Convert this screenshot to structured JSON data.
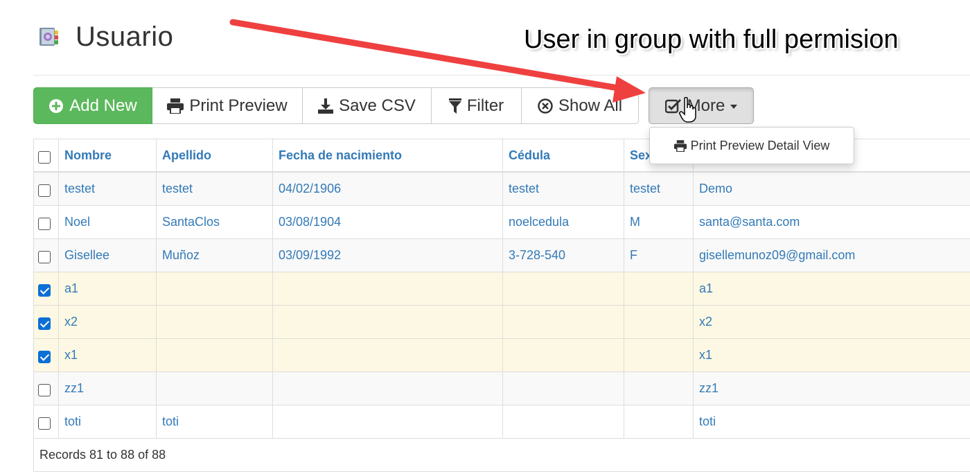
{
  "page": {
    "title": "Usuario",
    "annotation": "User in group with full permision"
  },
  "toolbar": {
    "add_new": "Add New",
    "print_preview": "Print Preview",
    "save_csv": "Save CSV",
    "filter": "Filter",
    "show_all": "Show All",
    "more": "More"
  },
  "dropdown": {
    "items": [
      "Print Preview Detail View"
    ]
  },
  "table": {
    "columns": [
      "Nombre",
      "Apellido",
      "Fecha de nacimiento",
      "Cédula",
      "Sex",
      ""
    ],
    "rows": [
      {
        "checked": false,
        "cells": [
          "testet",
          "testet",
          "04/02/1906",
          "testet",
          "testet",
          "Demo"
        ]
      },
      {
        "checked": false,
        "cells": [
          "Noel",
          "SantaClos",
          "03/08/1904",
          "noelcedula",
          "M",
          "santa@santa.com"
        ]
      },
      {
        "checked": false,
        "cells": [
          "Gisellee",
          "Muñoz",
          "03/09/1992",
          "3-728-540",
          "F",
          "gisellemunoz09@gmail.com"
        ]
      },
      {
        "checked": true,
        "cells": [
          "a1",
          "",
          "",
          "",
          "",
          "a1"
        ]
      },
      {
        "checked": true,
        "cells": [
          "x2",
          "",
          "",
          "",
          "",
          "x2"
        ]
      },
      {
        "checked": true,
        "cells": [
          "x1",
          "",
          "",
          "",
          "",
          "x1"
        ]
      },
      {
        "checked": false,
        "cells": [
          "zz1",
          "",
          "",
          "",
          "",
          "zz1"
        ]
      },
      {
        "checked": false,
        "cells": [
          "toti",
          "toti",
          "",
          "",
          "",
          "toti"
        ]
      }
    ],
    "footer": "Records 81 to 88 of 88"
  },
  "colors": {
    "success": "#5cb85c",
    "link": "#337ab7",
    "selected_row": "#fcf8e3",
    "annotation_arrow": "#ef4040"
  },
  "icons": [
    "app-book-icon",
    "plus-circle-icon",
    "printer-icon",
    "download-icon",
    "filter-icon",
    "times-circle-icon",
    "check-square-icon",
    "hand-cursor-icon"
  ]
}
